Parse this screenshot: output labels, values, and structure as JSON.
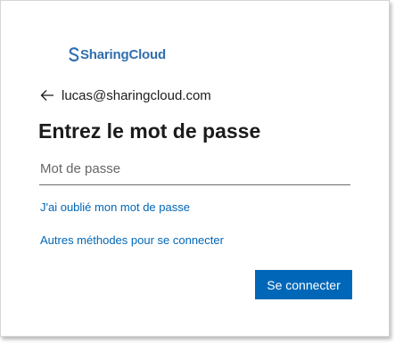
{
  "brand": {
    "name": "SharingCloud",
    "color": "#2f6fb0"
  },
  "identity": {
    "email": "lucas@sharingcloud.com",
    "back_icon": "arrow-left-icon"
  },
  "title": "Entrez le mot de passe",
  "password": {
    "value": "",
    "placeholder": "Mot de passe"
  },
  "links": {
    "forgot": "J'ai oublié mon mot de passe",
    "other_methods": "Autres méthodes pour se connecter",
    "color": "#0067b8"
  },
  "actions": {
    "signin_label": "Se connecter",
    "signin_color": "#0067b8"
  }
}
